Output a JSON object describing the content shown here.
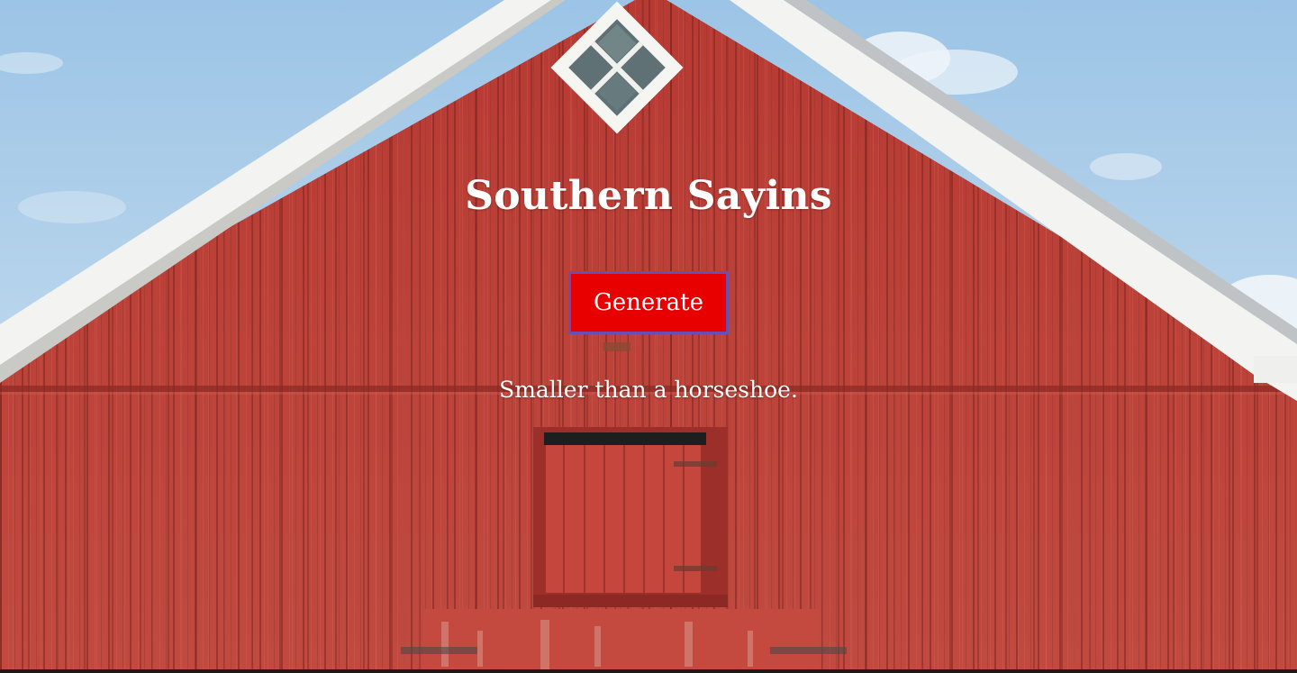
{
  "app": {
    "title": "Southern Sayins"
  },
  "controls": {
    "generate_label": "Generate"
  },
  "output": {
    "saying": "Smaller than a horseshoe."
  },
  "colors": {
    "button_bg": "#e80000",
    "button_border": "#6a4fb3",
    "text": "#ffffff",
    "barn_red": "#b8342f",
    "trim_white": "#f2f2f0",
    "sky": "#a9cbe6"
  },
  "background": {
    "description_icon": "red-barn-image"
  }
}
